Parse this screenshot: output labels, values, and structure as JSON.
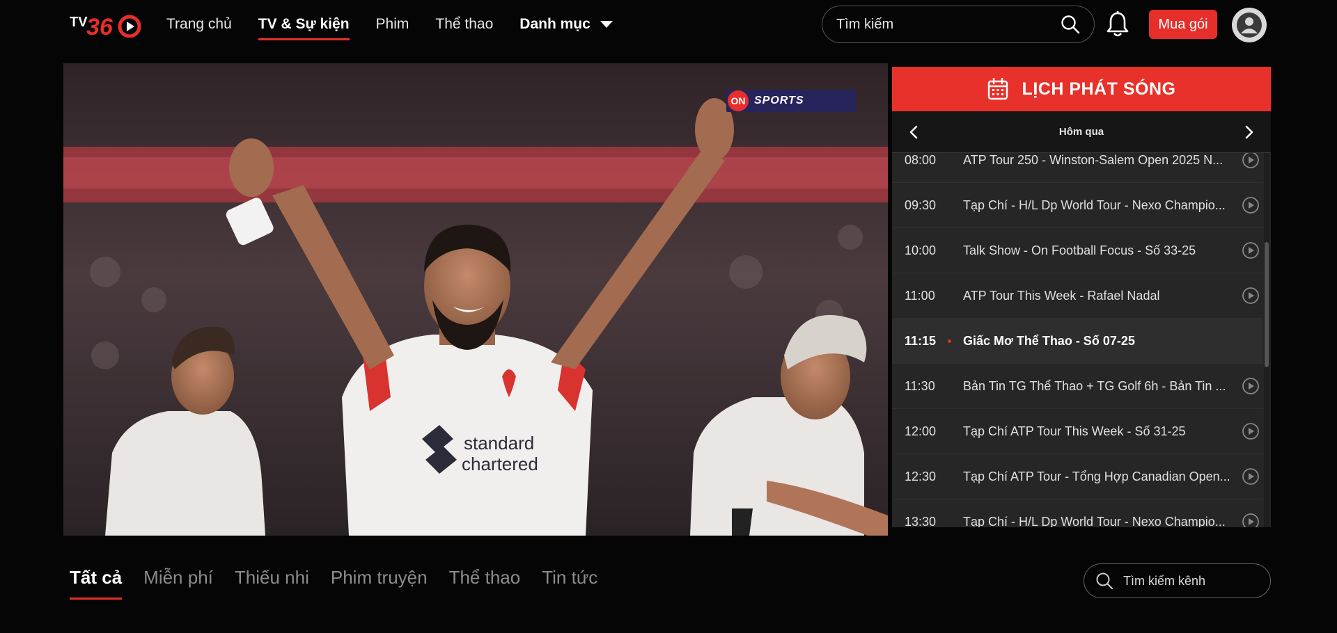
{
  "brand": {
    "logo_text": "TV360",
    "accent": "#e62e2a"
  },
  "nav": {
    "items": [
      {
        "label": "Trang chủ",
        "active": false
      },
      {
        "label": "TV & Sự kiện",
        "active": true
      },
      {
        "label": "Phim",
        "active": false
      },
      {
        "label": "Thể thao",
        "active": false
      },
      {
        "label": "Danh mục",
        "active": false,
        "dropdown": true
      }
    ]
  },
  "search": {
    "placeholder": "Tìm kiếm",
    "icon": "search-icon"
  },
  "header": {
    "notification_icon": "bell-icon",
    "buy_label": "Mua gói",
    "avatar_icon": "user-avatar-icon"
  },
  "player": {
    "channel_logo": {
      "badge": "ON",
      "text": "SPORTS"
    }
  },
  "schedule": {
    "title": "LỊCH PHÁT SÓNG",
    "title_icon": "calendar-icon",
    "day_label": "Hôm qua",
    "prev_icon": "chevron-left-icon",
    "next_icon": "chevron-right-icon",
    "items": [
      {
        "time": "08:00",
        "title": "ATP Tour 250 - Winston-Salem Open 2025 N...",
        "current": false
      },
      {
        "time": "09:30",
        "title": "Tạp Chí - H/L Dp World Tour - Nexo Champio...",
        "current": false
      },
      {
        "time": "10:00",
        "title": "Talk Show - On Football Focus - Số 33-25",
        "current": false
      },
      {
        "time": "11:00",
        "title": "ATP Tour This Week - Rafael Nadal",
        "current": false
      },
      {
        "time": "11:15",
        "title": "Giấc Mơ Thể Thao - Số 07-25",
        "current": true
      },
      {
        "time": "11:30",
        "title": "Bản Tin TG Thể Thao + TG Golf 6h - Bản Tin ...",
        "current": false
      },
      {
        "time": "12:00",
        "title": "Tạp Chí ATP Tour This Week - Số 31-25",
        "current": false
      },
      {
        "time": "12:30",
        "title": "Tạp Chí ATP Tour - Tổng Hợp Canadian Open...",
        "current": false
      },
      {
        "time": "13:30",
        "title": "Tạp Chí - H/L Dp World Tour - Nexo Champio...",
        "current": false
      }
    ]
  },
  "categories": {
    "items": [
      {
        "label": "Tất cả",
        "active": true
      },
      {
        "label": "Miễn phí",
        "active": false
      },
      {
        "label": "Thiếu nhi",
        "active": false
      },
      {
        "label": "Phim truyện",
        "active": false
      },
      {
        "label": "Thể thao",
        "active": false
      },
      {
        "label": "Tin tức",
        "active": false
      }
    ],
    "search_placeholder": "Tìm kiếm kênh"
  }
}
